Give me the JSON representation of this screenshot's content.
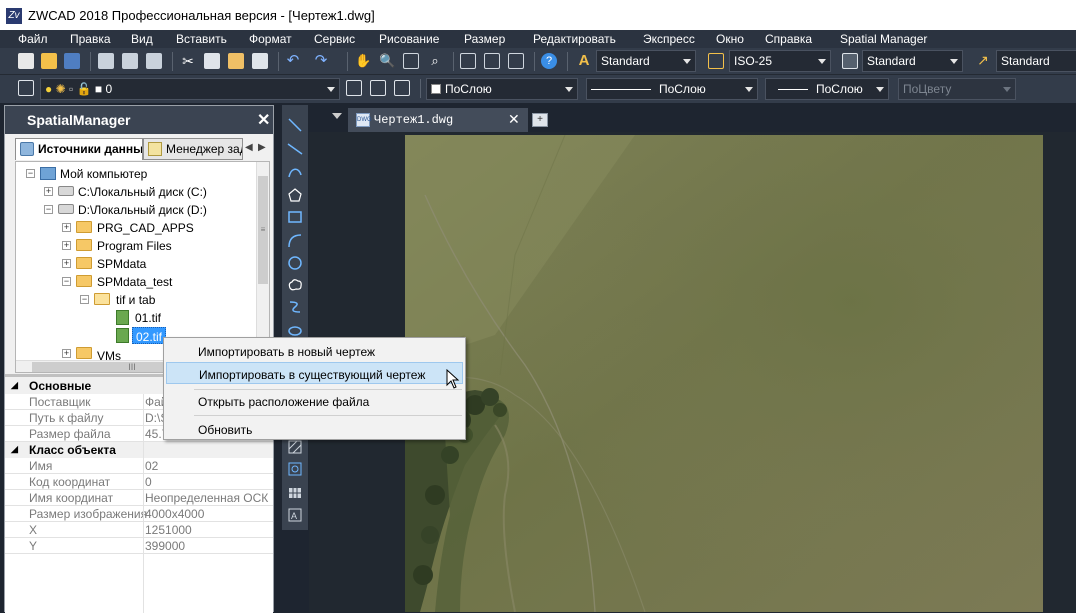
{
  "window": {
    "title": "ZWCAD 2018 Профессиональная версия - [Чертеж1.dwg]",
    "app_icon": "zwcad-logo"
  },
  "menu": [
    "Файл",
    "Правка",
    "Вид",
    "Вставить",
    "Формат",
    "Сервис",
    "Рисование",
    "Размер",
    "Редактировать",
    "Экспресс",
    "Окно",
    "Справка",
    "Spatial Manager"
  ],
  "toolbar": {
    "text_style": "Standard",
    "dim_style": "ISO-25",
    "table_style": "Standard",
    "multileader_style": "Standard",
    "layer_value": "0",
    "color": "ПоСлою",
    "linetype": "ПоСлою",
    "lineweight": "ПоСлою",
    "plotstyle": "ПоЦвету"
  },
  "panel": {
    "title": "SpatialManager",
    "tabs": [
      "Источники данных",
      "Менеджер зад"
    ],
    "tree": [
      {
        "label": "Мой компьютер",
        "icon": "computer-icon"
      },
      {
        "label": "C:\\Локальный диск (C:)",
        "icon": "drive-icon"
      },
      {
        "label": "D:\\Локальный диск (D:)",
        "icon": "drive-icon"
      },
      {
        "label": "PRG_CAD_APPS",
        "icon": "folder-icon"
      },
      {
        "label": "Program Files",
        "icon": "folder-icon"
      },
      {
        "label": "SPMdata",
        "icon": "folder-icon"
      },
      {
        "label": "SPMdata_test",
        "icon": "folder-icon"
      },
      {
        "label": "tif и tab",
        "icon": "folder-open-icon"
      },
      {
        "label": "01.tif",
        "icon": "tif-file-icon"
      },
      {
        "label": "02.tif",
        "icon": "tif-file-icon"
      },
      {
        "label": "VMs",
        "icon": "folder-icon"
      }
    ],
    "scroll_label": "III"
  },
  "properties": {
    "cat_basic": "Основные",
    "rows_basic": [
      {
        "name": "Поставщик",
        "value": "Фай"
      },
      {
        "name": "Путь к файлу",
        "value": "D:\\S"
      },
      {
        "name": "Размер файла",
        "value": "45.7"
      }
    ],
    "cat_object": "Класс объекта",
    "rows_object": [
      {
        "name": "Имя",
        "value": "02"
      },
      {
        "name": "Код координат",
        "value": "0"
      },
      {
        "name": "Имя координат",
        "value": "Неопределенная ОСК"
      },
      {
        "name": "Размер изображения",
        "value": "4000x4000"
      },
      {
        "name": "X",
        "value": "1251000"
      },
      {
        "name": "Y",
        "value": "399000"
      }
    ]
  },
  "doc_tab": {
    "label": "Чертеж1.dwg",
    "badge": "DWG"
  },
  "context_menu": {
    "items": [
      "Импортировать в новый чертеж",
      "Импортировать в существующий чертеж",
      "Открыть расположение файла",
      "Обновить"
    ],
    "highlighted_index": 1
  },
  "colors": {
    "accent": "#2b78d4",
    "highlight": "#cce4f7",
    "selection": "#3399ff"
  }
}
